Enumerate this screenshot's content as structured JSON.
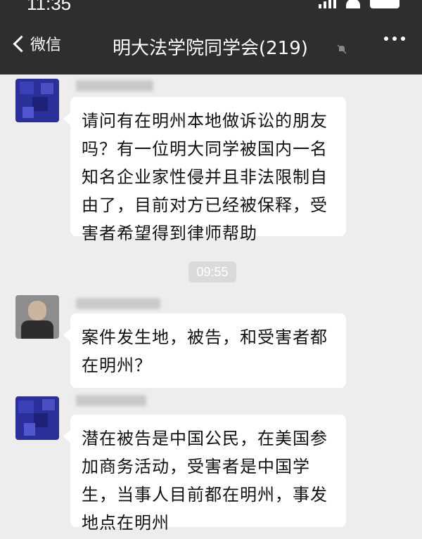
{
  "status_bar": {
    "time": "11:35"
  },
  "nav": {
    "back_label": "微信",
    "title": "明大法学院同学会(219)",
    "more_icon": "more-dots-icon",
    "mute_icon": "mute-bell-icon"
  },
  "messages": [
    {
      "sender_avatar": "blurred-blue-avatar",
      "lines": [
        "请问有在明州本地做诉讼的朋友",
        "吗？有一位明大同学被国内一名",
        "知名企业家性侵并且非法限制自",
        "由了，目前对方已经被保释，受",
        "害者希望得到律师帮助"
      ]
    },
    {
      "sender_avatar": "blurred-photo-avatar",
      "lines": [
        "案件发生地，被告，和受害者都",
        "在明州？"
      ]
    },
    {
      "sender_avatar": "blurred-blue-avatar",
      "lines": [
        "潜在被告是中国公民，在美国参",
        "加商务活动，受害者是中国学",
        "生，当事人目前都在明州，事发",
        "地点在明州"
      ]
    }
  ],
  "timestamp": "09:55"
}
